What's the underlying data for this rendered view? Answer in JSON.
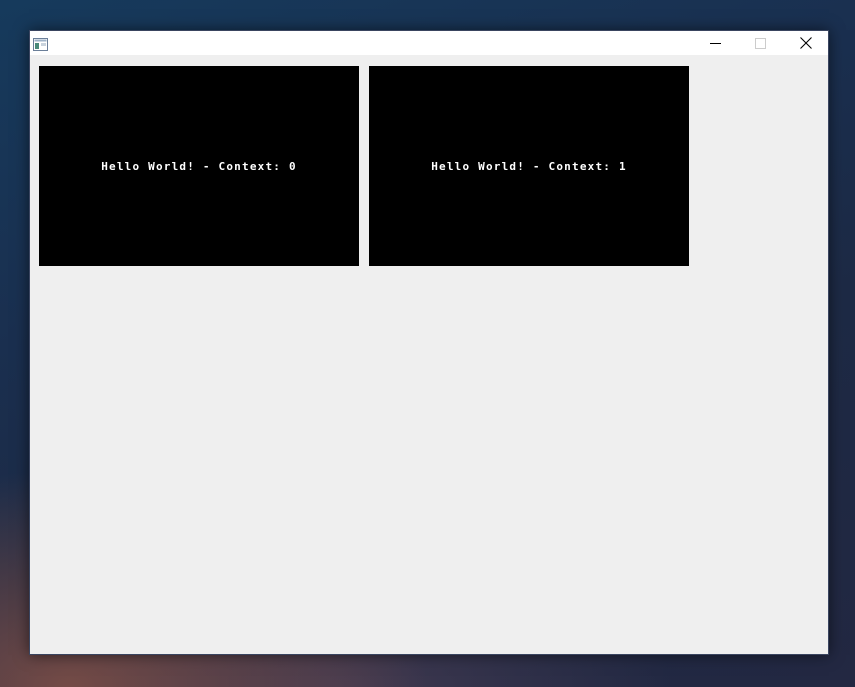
{
  "window": {
    "title": "",
    "icons": {
      "app": "app-window-icon",
      "minimize": "minimize-icon",
      "maximize": "maximize-icon",
      "close": "close-icon"
    }
  },
  "contexts": [
    {
      "label": "Hello World! - Context: 0"
    },
    {
      "label": "Hello World! - Context: 1"
    }
  ],
  "colors": {
    "client_background": "#efefef",
    "titlebar_background": "#ffffff",
    "panel_background": "#000000",
    "panel_text": "#ffffff"
  }
}
